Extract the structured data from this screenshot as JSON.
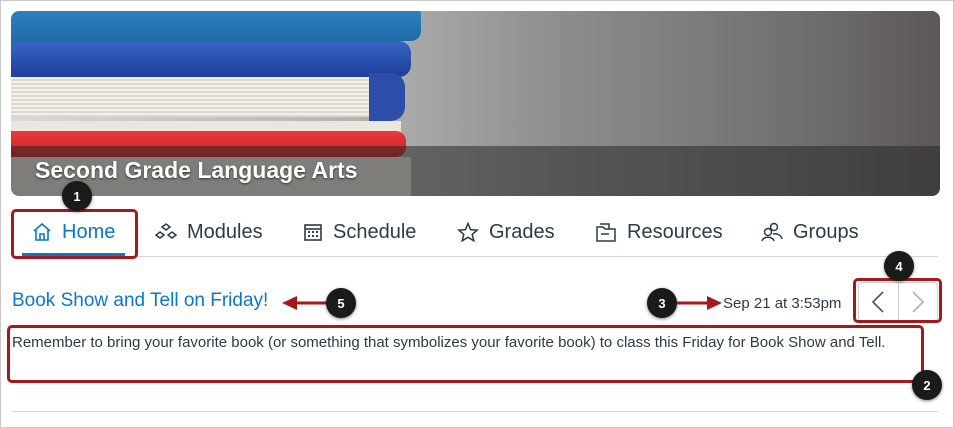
{
  "course": {
    "title": "Second Grade Language Arts"
  },
  "tabs": [
    {
      "label": "Home",
      "icon": "home-icon",
      "active": true
    },
    {
      "label": "Modules",
      "icon": "modules-icon"
    },
    {
      "label": "Schedule",
      "icon": "calendar-icon"
    },
    {
      "label": "Grades",
      "icon": "star-icon"
    },
    {
      "label": "Resources",
      "icon": "resources-icon"
    },
    {
      "label": "Groups",
      "icon": "groups-icon"
    }
  ],
  "announcement": {
    "title": "Book Show and Tell on Friday!",
    "date": "Sep 21 at 3:53pm",
    "body": "Remember to bring your favorite book (or something that symbolizes your favorite book) to class this Friday for Book Show and Tell."
  },
  "callouts": [
    "1",
    "2",
    "3",
    "4",
    "5"
  ],
  "colors": {
    "accent": "#0b79c1",
    "callout": "#a31a1d",
    "text": "#2d3b45"
  }
}
